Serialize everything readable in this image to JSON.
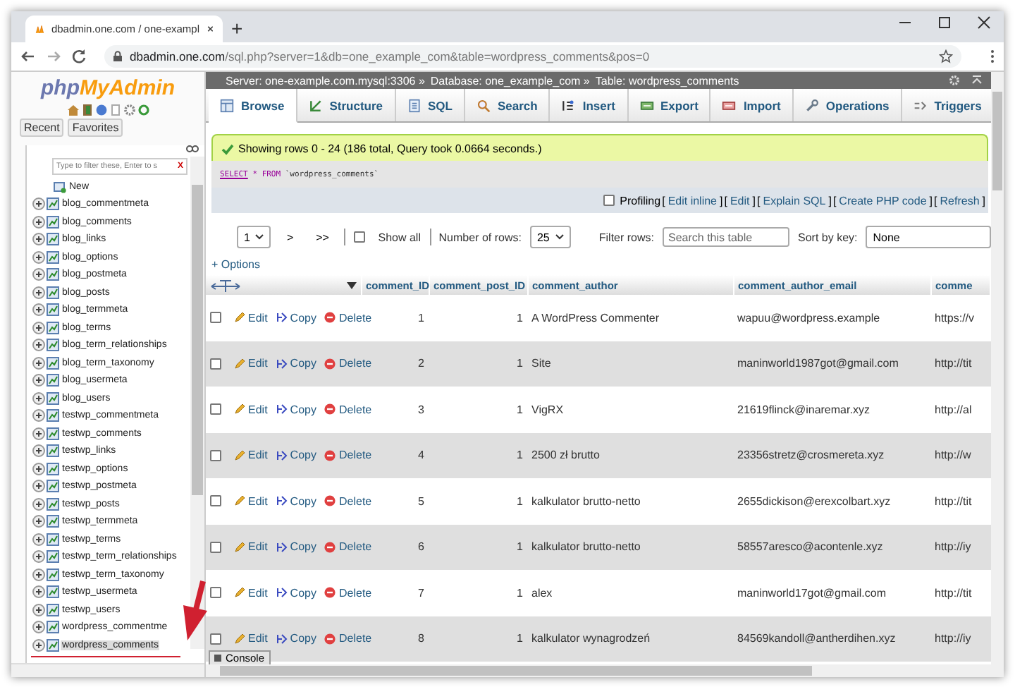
{
  "browser": {
    "tab_title": "dbadmin.one.com / one-exampl",
    "new_tab": "+",
    "url_host": "dbadmin.one.com",
    "url_path": "/sql.php?server=1&db=one_example_com&table=wordpress_comments&pos=0"
  },
  "sidebar": {
    "logo_php": "php",
    "logo_myadmin": "MyAdmin",
    "buttons": [
      "Recent",
      "Favorites"
    ],
    "filter": {
      "placeholder": "Type to filter these, Enter to s",
      "clear": "X"
    },
    "new_label": "New",
    "tables": [
      {
        "name": "blog_commentmeta",
        "selected": false
      },
      {
        "name": "blog_comments",
        "selected": false
      },
      {
        "name": "blog_links",
        "selected": false
      },
      {
        "name": "blog_options",
        "selected": false
      },
      {
        "name": "blog_postmeta",
        "selected": false
      },
      {
        "name": "blog_posts",
        "selected": false
      },
      {
        "name": "blog_termmeta",
        "selected": false
      },
      {
        "name": "blog_terms",
        "selected": false
      },
      {
        "name": "blog_term_relationships",
        "selected": false
      },
      {
        "name": "blog_term_taxonomy",
        "selected": false
      },
      {
        "name": "blog_usermeta",
        "selected": false
      },
      {
        "name": "blog_users",
        "selected": false
      },
      {
        "name": "testwp_commentmeta",
        "selected": false
      },
      {
        "name": "testwp_comments",
        "selected": false
      },
      {
        "name": "testwp_links",
        "selected": false
      },
      {
        "name": "testwp_options",
        "selected": false
      },
      {
        "name": "testwp_postmeta",
        "selected": false
      },
      {
        "name": "testwp_posts",
        "selected": false
      },
      {
        "name": "testwp_termmeta",
        "selected": false
      },
      {
        "name": "testwp_terms",
        "selected": false
      },
      {
        "name": "testwp_term_relationships",
        "selected": false
      },
      {
        "name": "testwp_term_taxonomy",
        "selected": false
      },
      {
        "name": "testwp_usermeta",
        "selected": false
      },
      {
        "name": "testwp_users",
        "selected": false
      },
      {
        "name": "wordpress_commentme",
        "selected": false
      },
      {
        "name": "wordpress_comments",
        "selected": true
      }
    ]
  },
  "breadcrumb": [
    "Server: one-example.com.mysql:3306 »",
    "Database: one_example_com »",
    "Table: wordpress_comments"
  ],
  "tabs": [
    {
      "label": "Browse",
      "selected": true
    },
    {
      "label": "Structure",
      "selected": false
    },
    {
      "label": "SQL",
      "selected": false
    },
    {
      "label": "Search",
      "selected": false
    },
    {
      "label": "Insert",
      "selected": false
    },
    {
      "label": "Export",
      "selected": false
    },
    {
      "label": "Import",
      "selected": false
    },
    {
      "label": "Operations",
      "selected": false
    },
    {
      "label": "Triggers",
      "selected": false
    }
  ],
  "message": "Showing rows 0 - 24 (186 total, Query took 0.0664 seconds.)",
  "sql": {
    "keyword_1": "SELECT",
    "operator": "*",
    "keyword_2": "FROM",
    "identifier": "`wordpress_comments`"
  },
  "profiling": {
    "checked": false,
    "label": "Profiling",
    "links": [
      {
        "before": "[",
        "label": "Edit inline",
        "after": "]"
      },
      {
        "before": "[",
        "label": "Edit",
        "after": "]"
      },
      {
        "before": "[",
        "label": "Explain SQL",
        "after": "]"
      },
      {
        "before": "[",
        "label": "Create PHP code",
        "after": "]"
      },
      {
        "before": "[",
        "label": "Refresh",
        "after": "]"
      }
    ]
  },
  "navigation": {
    "page": "1",
    "next": ">",
    "last": ">>",
    "show_all": {
      "label": "Show all",
      "checked": false
    },
    "rows_label": "Number of rows:",
    "rows_value": "25",
    "filter_label": "Filter rows:",
    "filter_placeholder": "Search this table",
    "sort_label": "Sort by key:",
    "sort_value": "None"
  },
  "options_link": "+ Options",
  "table": {
    "columns": [
      "comment_ID",
      "comment_post_ID",
      "comment_author",
      "comment_author_email",
      "comme"
    ],
    "rows": [
      {
        "checked": false,
        "actions": [
          "Edit",
          "Copy",
          "Delete"
        ],
        "cells": [
          "1",
          "1",
          "A WordPress Commenter",
          "wapuu@wordpress.example",
          "https://v"
        ]
      },
      {
        "checked": false,
        "actions": [
          "Edit",
          "Copy",
          "Delete"
        ],
        "cells": [
          "2",
          "1",
          "Site",
          "maninworld1987got@gmail.com",
          "http://tit"
        ]
      },
      {
        "checked": false,
        "actions": [
          "Edit",
          "Copy",
          "Delete"
        ],
        "cells": [
          "3",
          "1",
          "VigRX",
          "21619flinck@inaremar.xyz",
          "http://al"
        ]
      },
      {
        "checked": false,
        "actions": [
          "Edit",
          "Copy",
          "Delete"
        ],
        "cells": [
          "4",
          "1",
          "2500 zł brutto",
          "23356stretz@crosmereta.xyz",
          "http://w"
        ]
      },
      {
        "checked": false,
        "actions": [
          "Edit",
          "Copy",
          "Delete"
        ],
        "cells": [
          "5",
          "1",
          "kalkulator brutto-netto",
          "2655dickison@erexcolbart.xyz",
          "http://tit"
        ]
      },
      {
        "checked": false,
        "actions": [
          "Edit",
          "Copy",
          "Delete"
        ],
        "cells": [
          "6",
          "1",
          "kalkulator brutto-netto",
          "58557aresco@acontenle.xyz",
          "http://iy"
        ]
      },
      {
        "checked": false,
        "actions": [
          "Edit",
          "Copy",
          "Delete"
        ],
        "cells": [
          "7",
          "1",
          "alex",
          "maninworld17got@gmail.com",
          "http://tit"
        ]
      },
      {
        "checked": false,
        "actions": [
          "Edit",
          "Copy",
          "Delete"
        ],
        "cells": [
          "8",
          "1",
          "kalkulator wynagrodzeń",
          "84569kandoll@antherdihen.xyz",
          "http://iy"
        ]
      }
    ]
  },
  "console": "Console"
}
